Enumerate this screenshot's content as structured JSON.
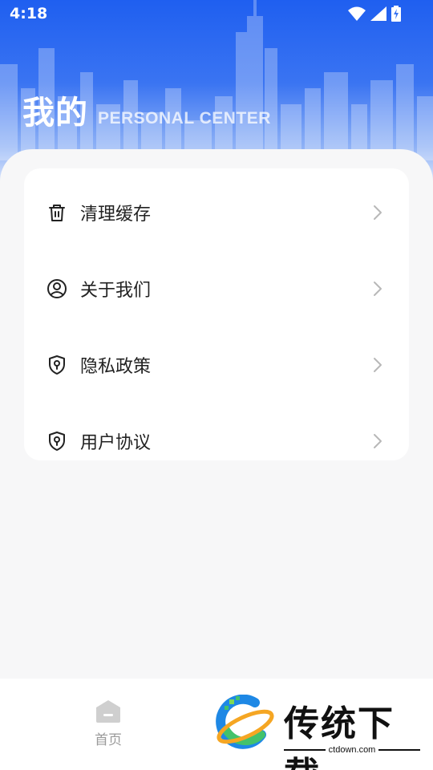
{
  "status_bar": {
    "time": "4:18",
    "icons": [
      "wifi-icon",
      "signal-icon",
      "battery-charging-icon"
    ]
  },
  "header": {
    "title": "我的",
    "subtitle": "PERSONAL CENTER"
  },
  "menu": {
    "items": [
      {
        "label": "清理缓存",
        "icon": "trash-icon"
      },
      {
        "label": "关于我们",
        "icon": "user-circle-icon"
      },
      {
        "label": "隐私政策",
        "icon": "shield-lock-icon"
      },
      {
        "label": "用户协议",
        "icon": "shield-lock-icon"
      }
    ]
  },
  "bottom_nav": {
    "home_label": "首页",
    "home_icon": "home-icon"
  },
  "watermark": {
    "brand": "传统下载",
    "url": "ctdown.com"
  },
  "colors": {
    "header_blue": "#1f5ff0",
    "background": "#f7f7f8",
    "card": "#ffffff",
    "nav_gray": "#9a9a9a"
  }
}
